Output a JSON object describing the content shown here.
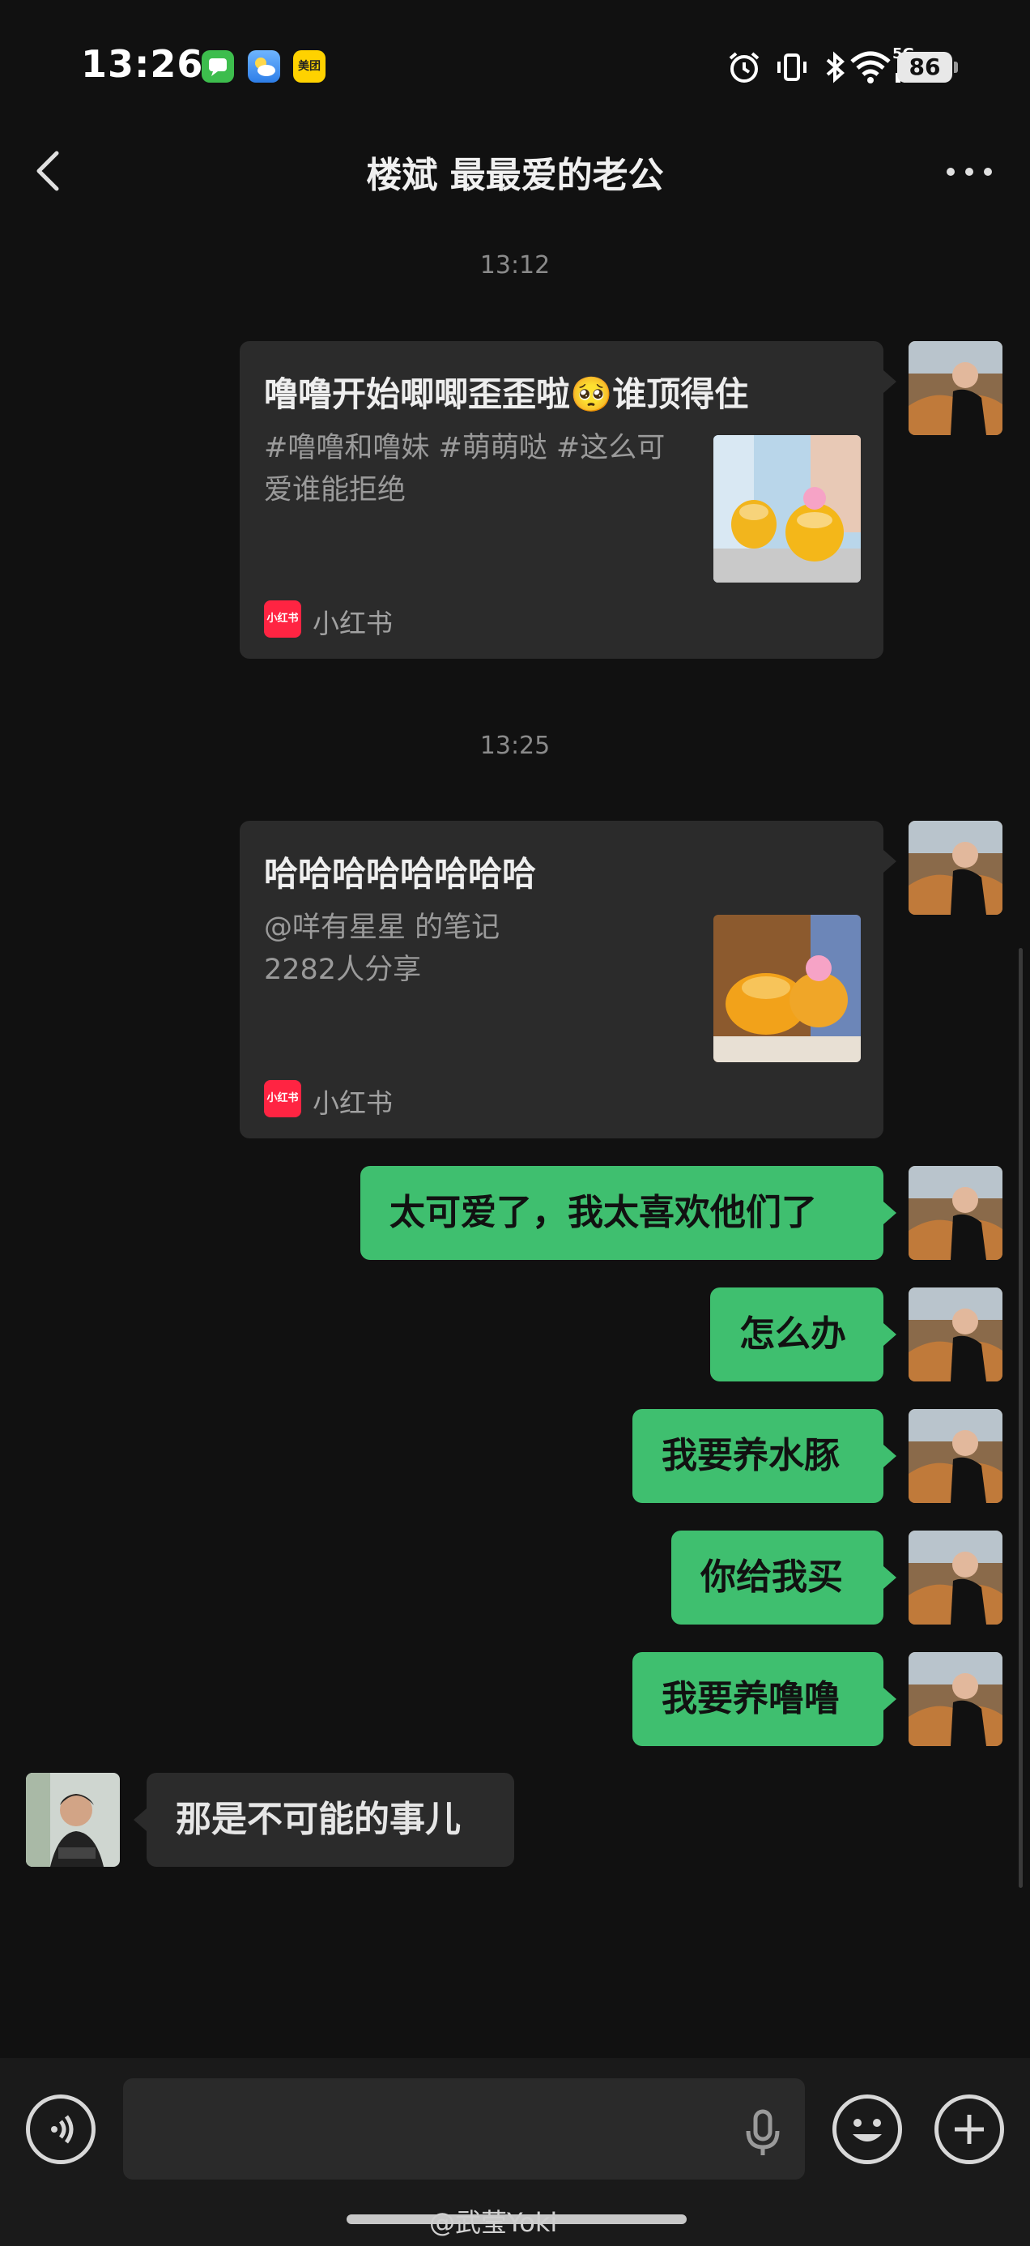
{
  "status_bar": {
    "time": "13:26",
    "app_icons": [
      "messages-icon",
      "weather-icon",
      "meituan-icon"
    ],
    "meituan_label": "美团",
    "network": "5G",
    "battery": "86"
  },
  "header": {
    "title": "楼斌 最最爱的老公"
  },
  "messages": {
    "ts1": "13:12",
    "card1": {
      "title": "噜噜开始唧唧歪歪啦🥺谁顶得住",
      "desc": "#噜噜和噜妹 #萌萌哒 #这么可爱谁能拒绝",
      "logo_text": "小红书",
      "source": "小红书"
    },
    "ts2": "13:25",
    "card2": {
      "title": "哈哈哈哈哈哈哈哈",
      "desc_line1": "@咩有星星 的笔记",
      "desc_line2": "2282人分享",
      "logo_text": "小红书",
      "source": "小红书"
    },
    "m1": "太可爱了，我太喜欢他们了",
    "m2": "怎么办",
    "m3": "我要养水豚",
    "m4": "你给我买",
    "m5": "我要养噜噜",
    "reply": "那是不可能的事儿"
  },
  "input_bar": {
    "voice": "voice-icon",
    "mic": "mic-icon",
    "emoji": "emoji-icon",
    "plus": "plus-icon"
  },
  "watermark": "@武莹Yoki",
  "colors": {
    "background": "#111111",
    "bubble_self": "#3fbf6f",
    "bubble_other": "#2b2b2b",
    "xiaohongshu": "#ff2442"
  }
}
